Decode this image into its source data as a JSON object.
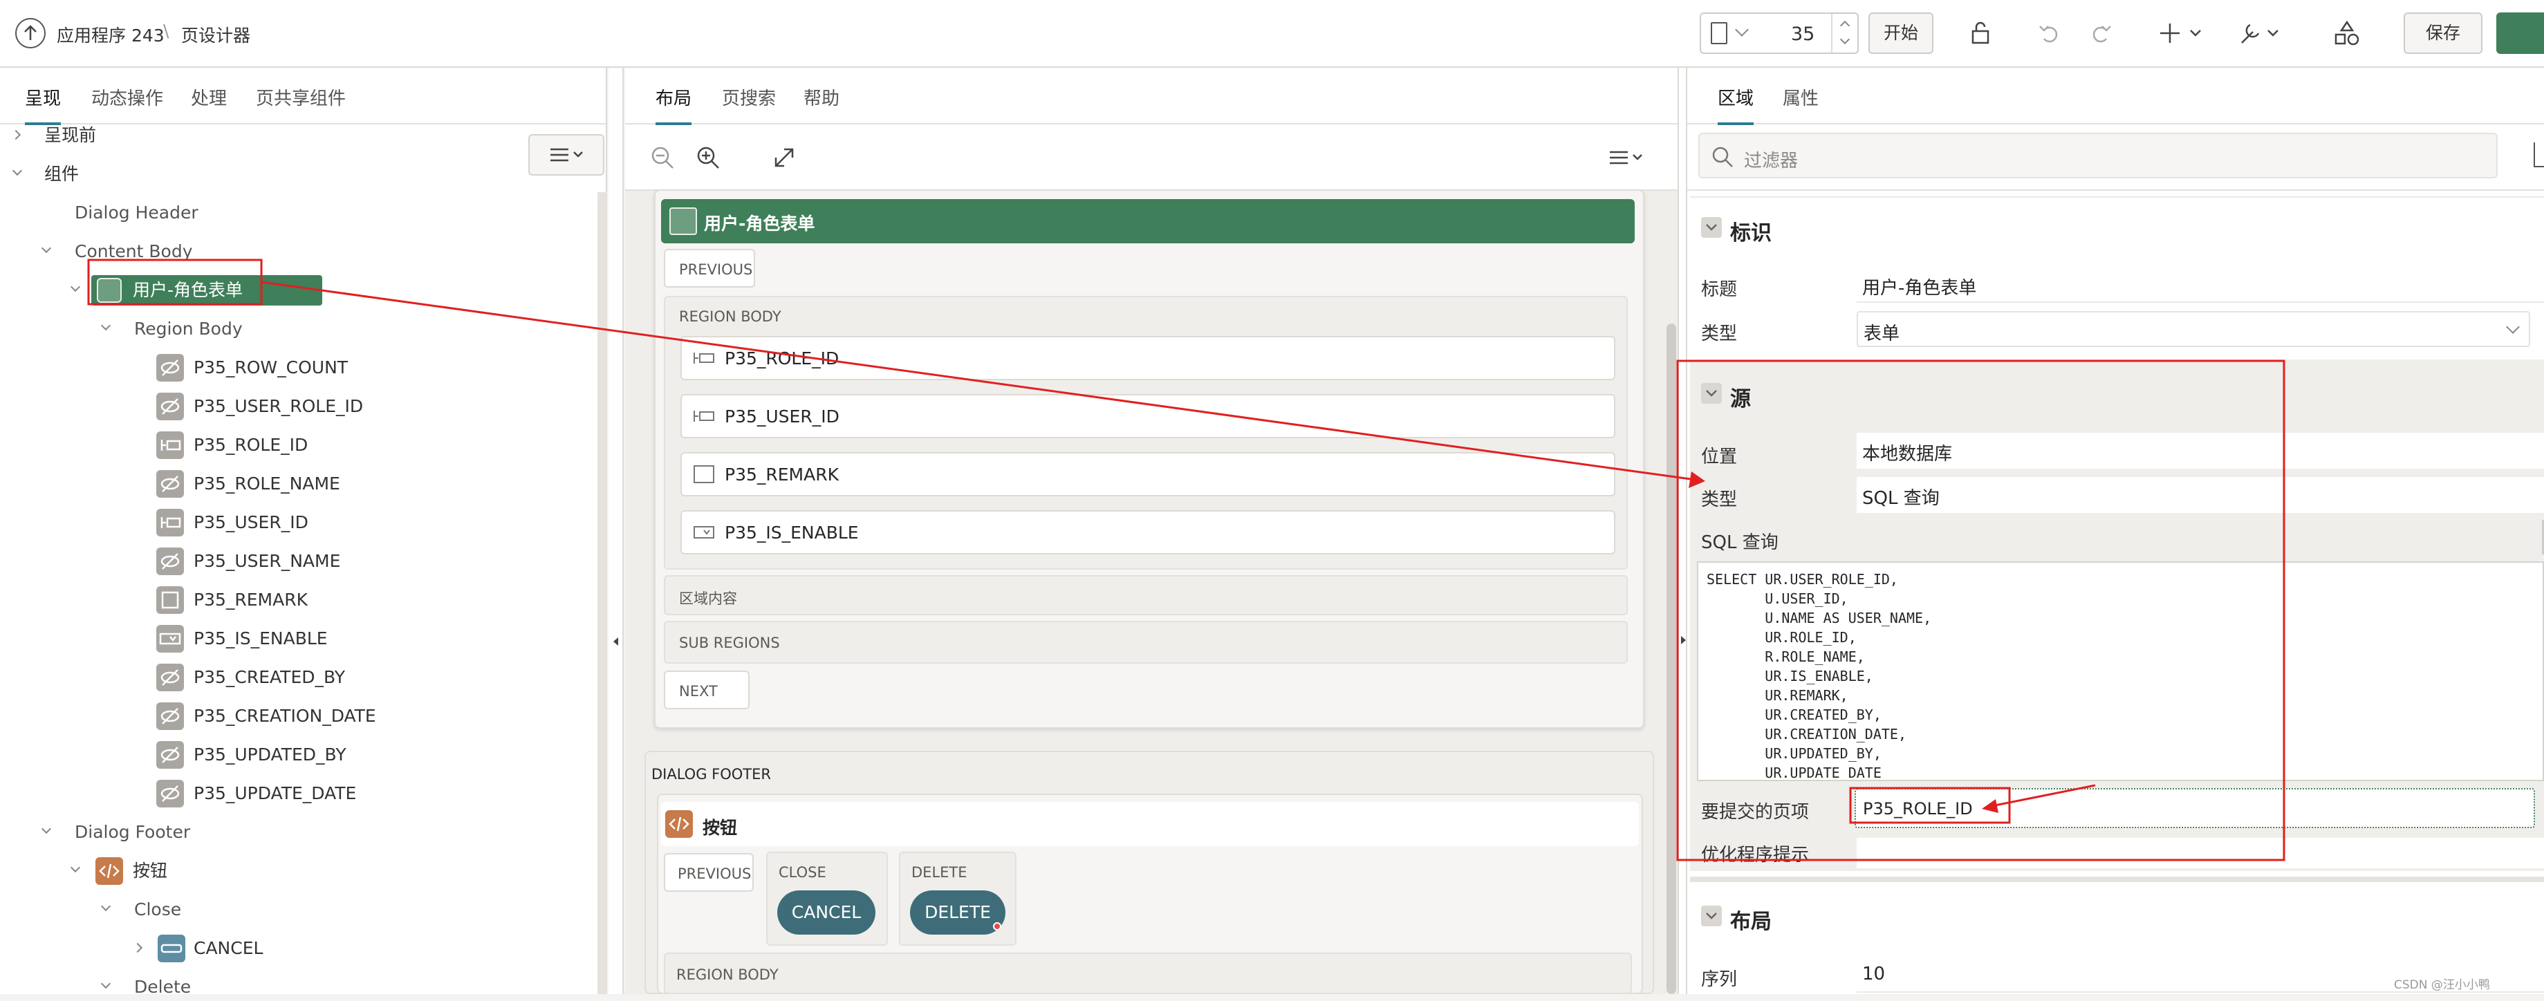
{
  "header": {
    "app_label": "应用程序 243",
    "separator": "\\",
    "page_designer": "页设计器",
    "page_number": "35",
    "run_label": "开始",
    "save_label": "保存"
  },
  "left_panel": {
    "tabs": [
      "呈现",
      "动态操作",
      "处理",
      "页共享组件"
    ],
    "tree": {
      "pre_render": "呈现前",
      "components": "组件",
      "dialog_header": "Dialog Header",
      "content_body": "Content Body",
      "region_form": "用户-角色表单",
      "region_body": "Region Body",
      "items": [
        "P35_ROW_COUNT",
        "P35_USER_ROLE_ID",
        "P35_ROLE_ID",
        "P35_ROLE_NAME",
        "P35_USER_ID",
        "P35_USER_NAME",
        "P35_REMARK",
        "P35_IS_ENABLE",
        "P35_CREATED_BY",
        "P35_CREATION_DATE",
        "P35_UPDATED_BY",
        "P35_UPDATE_DATE"
      ],
      "dialog_footer": "Dialog Footer",
      "buttons_region": "按钮",
      "close": "Close",
      "cancel": "CANCEL",
      "delete": "Delete"
    }
  },
  "middle_panel": {
    "tabs": [
      "布局",
      "页搜索",
      "帮助"
    ],
    "region_title": "用户-角色表单",
    "previous": "PREVIOUS",
    "region_body": "REGION BODY",
    "items": [
      "P35_ROLE_ID",
      "P35_USER_ID",
      "P35_REMARK",
      "P35_IS_ENABLE"
    ],
    "region_content": "区域内容",
    "sub_regions": "SUB REGIONS",
    "next": "NEXT",
    "dialog_footer": "DIALOG FOOTER",
    "buttons_title": "按钮",
    "footer_previous": "PREVIOUS",
    "close_label": "CLOSE",
    "cancel_button": "CANCEL",
    "delete_label": "DELETE",
    "delete_button": "DELETE",
    "footer_region_body": "REGION BODY"
  },
  "right_panel": {
    "tabs": [
      "区域",
      "属性"
    ],
    "filter_placeholder": "过滤器",
    "identification": {
      "title": "标识",
      "title_label": "标题",
      "title_value": "用户-角色表单",
      "type_label": "类型",
      "type_value": "表单"
    },
    "source": {
      "title": "源",
      "location_label": "位置",
      "location_value": "本地数据库",
      "type_label": "类型",
      "type_value": "SQL 查询",
      "sql_label": "SQL 查询",
      "sql": "SELECT UR.USER_ROLE_ID,\n       U.USER_ID,\n       U.NAME AS USER_NAME,\n       UR.ROLE_ID,\n       R.ROLE_NAME,\n       UR.IS_ENABLE,\n       UR.REMARK,\n       UR.CREATED_BY,\n       UR.CREATION_DATE,\n       UR.UPDATED_BY,\n       UR.UPDATE_DATE",
      "submit_items_label": "要提交的页项",
      "submit_items_value": "P35_ROLE_ID",
      "optimizer_label": "优化程序提示"
    },
    "layout": {
      "title": "布局",
      "sequence_label": "序列",
      "sequence_value": "10"
    },
    "watermark": "CSDN @汪小小鸭"
  },
  "colors": {
    "accent": "#2f7c93",
    "region_green": "#3f7f5a",
    "annotation_red": "#e02020",
    "button_teal": "#3e6d79"
  }
}
